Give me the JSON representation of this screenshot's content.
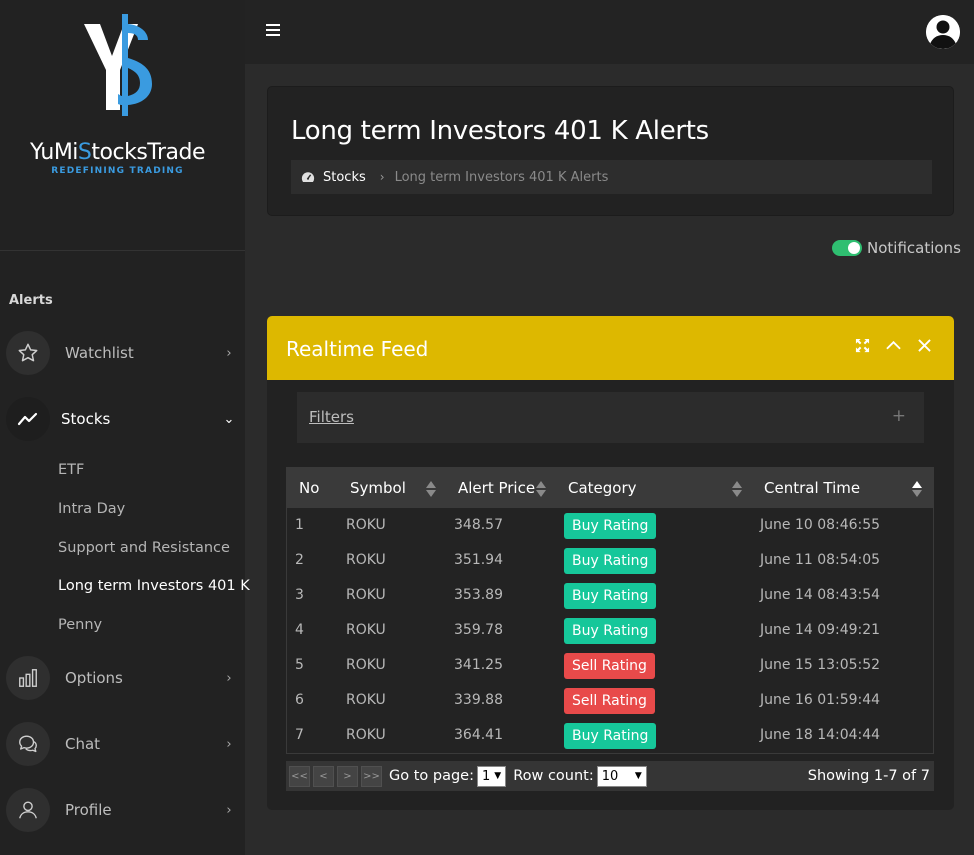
{
  "brand": {
    "name_pre": "YuMi",
    "name_s": "S",
    "name_post": "tocksTrade",
    "tagline": "REDEFINING TRADING",
    "accent": "#3a9be0"
  },
  "sidebar": {
    "section": "Alerts",
    "items": [
      {
        "label": "Watchlist",
        "icon": "star-icon"
      },
      {
        "label": "Stocks",
        "icon": "trend-line-icon"
      },
      {
        "label": "Options",
        "icon": "bar-chart-icon"
      },
      {
        "label": "Chat",
        "icon": "chat-icon"
      },
      {
        "label": "Profile",
        "icon": "user-icon"
      }
    ],
    "sub_items": [
      "ETF",
      "Intra Day",
      "Support and Resistance",
      "Long term Investors 401 K",
      "Penny"
    ]
  },
  "header": {
    "title": "Long term Investors 401 K Alerts"
  },
  "breadcrumb": {
    "root": "Stocks",
    "current": "Long term Investors 401 K Alerts"
  },
  "notifications": {
    "label": "Notifications",
    "enabled": true
  },
  "feed": {
    "title": "Realtime Feed",
    "header_color": "#ddb800",
    "filters_label": "Filters",
    "columns": [
      "No",
      "Symbol",
      "Alert Price",
      "Category",
      "Central Time"
    ],
    "rows": [
      {
        "no": "1",
        "symbol": "ROKU",
        "price": "348.57",
        "category": "Buy Rating",
        "type": "buy",
        "time": "June 10 08:46:55"
      },
      {
        "no": "2",
        "symbol": "ROKU",
        "price": "351.94",
        "category": "Buy Rating",
        "type": "buy",
        "time": "June 11 08:54:05"
      },
      {
        "no": "3",
        "symbol": "ROKU",
        "price": "353.89",
        "category": "Buy Rating",
        "type": "buy",
        "time": "June 14 08:43:54"
      },
      {
        "no": "4",
        "symbol": "ROKU",
        "price": "359.78",
        "category": "Buy Rating",
        "type": "buy",
        "time": "June 14 09:49:21"
      },
      {
        "no": "5",
        "symbol": "ROKU",
        "price": "341.25",
        "category": "Sell Rating",
        "type": "sell",
        "time": "June 15 13:05:52"
      },
      {
        "no": "6",
        "symbol": "ROKU",
        "price": "339.88",
        "category": "Sell Rating",
        "type": "sell",
        "time": "June 16 01:59:44"
      },
      {
        "no": "7",
        "symbol": "ROKU",
        "price": "364.41",
        "category": "Buy Rating",
        "type": "buy",
        "time": "June 18 14:04:44"
      }
    ],
    "badge_colors": {
      "buy": "#16c79a",
      "sell": "#e84a4a"
    }
  },
  "pager": {
    "first": "<<",
    "prev": "<",
    "next": ">",
    "last": ">>",
    "goto_label": "Go to page:",
    "page_value": "1",
    "rowcount_label": "Row count:",
    "rowcount_value": "10",
    "showing": "Showing 1-7 of 7"
  }
}
